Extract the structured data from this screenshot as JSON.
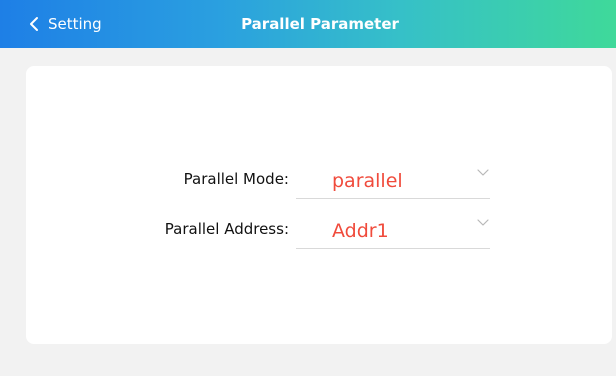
{
  "header": {
    "back_label": "Setting",
    "title": "Parallel Parameter"
  },
  "form": {
    "mode": {
      "label": "Parallel Mode:",
      "value": "parallel"
    },
    "address": {
      "label": "Parallel Address:",
      "value": "Addr1"
    }
  },
  "colors": {
    "value_text": "#f04b3c",
    "header_gradient_start": "#1e7fe6",
    "header_gradient_end": "#3fd99a"
  }
}
